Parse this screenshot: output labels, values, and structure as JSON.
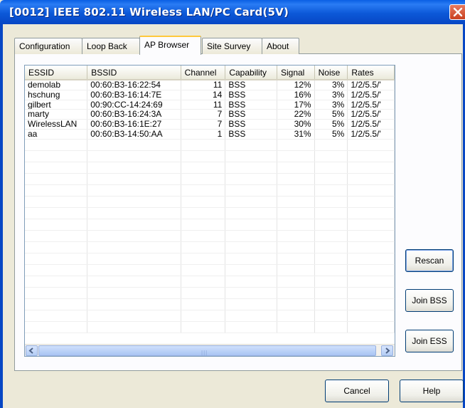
{
  "window": {
    "title": "[0012] IEEE 802.11 Wireless LAN/PC Card(5V)"
  },
  "tabs": [
    {
      "label": "Configuration"
    },
    {
      "label": "Loop Back"
    },
    {
      "label": "AP Browser"
    },
    {
      "label": "Site Survey"
    },
    {
      "label": "About"
    }
  ],
  "table": {
    "columns": [
      "ESSID",
      "BSSID",
      "Channel",
      "Capability",
      "Signal",
      "Noise",
      "Rates"
    ],
    "rows": [
      {
        "essid": "demolab",
        "bssid": "00:60:B3-16:22:54",
        "channel": "11",
        "capability": "BSS",
        "signal": "12%",
        "noise": "3%",
        "rates": "1/2/5.5/'"
      },
      {
        "essid": "hschung",
        "bssid": "00:60:B3-16:14:7E",
        "channel": "14",
        "capability": "BSS",
        "signal": "16%",
        "noise": "3%",
        "rates": "1/2/5.5/'"
      },
      {
        "essid": "gilbert",
        "bssid": "00:90:CC-14:24:69",
        "channel": "11",
        "capability": "BSS",
        "signal": "17%",
        "noise": "3%",
        "rates": "1/2/5.5/'"
      },
      {
        "essid": "marty",
        "bssid": "00:60:B3-16:24:3A",
        "channel": "7",
        "capability": "BSS",
        "signal": "22%",
        "noise": "5%",
        "rates": "1/2/5.5/'"
      },
      {
        "essid": "WirelessLAN",
        "bssid": "00:60:B3-16:1E:27",
        "channel": "7",
        "capability": "BSS",
        "signal": "30%",
        "noise": "5%",
        "rates": "1/2/5.5/'"
      },
      {
        "essid": "aa",
        "bssid": "00:60:B3-14:50:AA",
        "channel": "1",
        "capability": "BSS",
        "signal": "31%",
        "noise": "5%",
        "rates": "1/2/5.5/'"
      }
    ]
  },
  "buttons": {
    "rescan": "Rescan",
    "join_bss": "Join BSS",
    "join_ess": "Join ESS",
    "cancel": "Cancel",
    "help": "Help"
  },
  "icons": {
    "close": "close-icon",
    "scroll_left": "chevron-left-icon",
    "scroll_right": "chevron-right-icon"
  },
  "colors": {
    "title_bar": "#0a5fe4",
    "close_button": "#d9532f",
    "active_tab_accent": "#ffc83c"
  }
}
